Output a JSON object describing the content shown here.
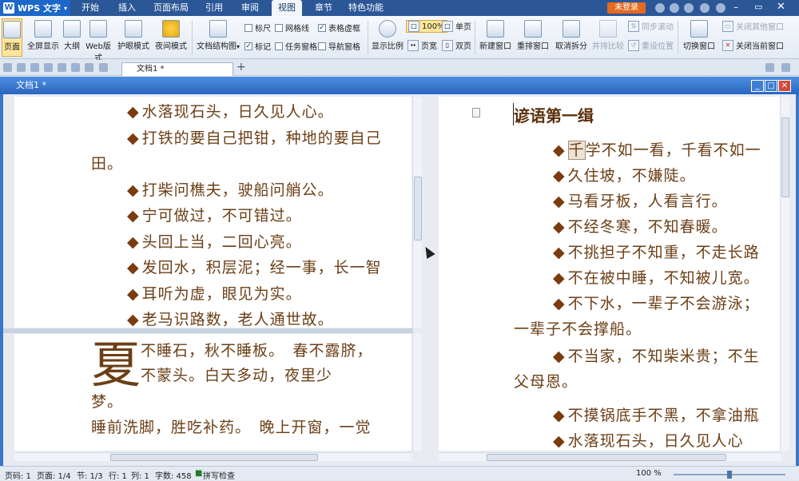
{
  "app": {
    "title": "WPS 文字",
    "login": "未登录"
  },
  "ribbon_tabs": [
    "开始",
    "插入",
    "页面布局",
    "引用",
    "审阅",
    "视图",
    "章节",
    "特色功能"
  ],
  "active_tab": "视图",
  "view_buttons": [
    "页面",
    "全屏显示",
    "大纲",
    "Web版式",
    "护眼模式",
    "夜间模式",
    "文档结构图"
  ],
  "checkboxes": [
    {
      "label": "标尺",
      "checked": false
    },
    {
      "label": "网格线",
      "checked": false
    },
    {
      "label": "表格虚框",
      "checked": true
    },
    {
      "label": "标记",
      "checked": true
    },
    {
      "label": "任务窗格",
      "checked": false
    },
    {
      "label": "导航窗格",
      "checked": false
    }
  ],
  "zoom_group": {
    "display_ratio": "显示比例",
    "zoom100": "100%",
    "page_width": "页宽",
    "single_page": "单页",
    "two_page": "双页"
  },
  "window_group": [
    "新建窗口",
    "重排窗口",
    "取消拆分",
    "并排比较"
  ],
  "sync_scroll": "同步滚动",
  "reset_pos": "重设位置",
  "switch_window": "切换窗口",
  "close_other": "关闭其他窗口",
  "close_current": "关闭当前窗口",
  "doc_tab": "文档1 *",
  "doc_window_title": "文档1 *",
  "left_top_lines": [
    {
      "bullet": true,
      "text": "水落现石头，日久见人心。"
    },
    {
      "bullet": true,
      "text": "打铁的要自己把钳，种地的要自己"
    },
    {
      "bullet": false,
      "text": "田。"
    },
    {
      "bullet": true,
      "text": "打柴问樵夫，驶船问艄公。"
    },
    {
      "bullet": true,
      "text": "宁可做过，不可错过。"
    },
    {
      "bullet": true,
      "text": "头回上当，二回心亮。"
    },
    {
      "bullet": true,
      "text": "发回水，积层泥；经一事，长一智"
    },
    {
      "bullet": true,
      "text": "耳听为虚，眼见为实。"
    },
    {
      "bullet": true,
      "text": "老马识路数，老人通世故。"
    }
  ],
  "left_bottom": {
    "big_char": "夏",
    "lines": [
      "不睡石，秋不睡板。　春不露脐，",
      "不蒙头。白天多动，夜里少",
      "梦。",
      "睡前洗脚，胜吃补药。　晚上开窗，一觉"
    ]
  },
  "right": {
    "heading": "谚语第一缉",
    "lines": [
      {
        "bullet": true,
        "text": "千学不如一看，千看不如一"
      },
      {
        "bullet": true,
        "text": "久住坡，不嫌陡。"
      },
      {
        "bullet": true,
        "text": "马看牙板，人看言行。"
      },
      {
        "bullet": true,
        "text": "不经冬寒，不知春暖。"
      },
      {
        "bullet": true,
        "text": "不挑担子不知重，不走长路"
      },
      {
        "bullet": true,
        "text": "不在被中睡，不知被儿宽。"
      },
      {
        "bullet": true,
        "text": "不下水，一辈子不会游泳；"
      },
      {
        "bullet": false,
        "text": "一辈子不会撑船。"
      },
      {
        "bullet": true,
        "text": "不当家，不知柴米贵；不生"
      },
      {
        "bullet": false,
        "text": "父母恩。"
      },
      {
        "bullet": true,
        "text": "不摸锅底手不黑，不拿油瓶"
      },
      {
        "bullet": true,
        "text": "水落现石头，日久见人心"
      }
    ]
  },
  "status": {
    "page": "页码: 1",
    "pages": "页面: 1/4",
    "section": "节: 1/3",
    "row": "行: 1",
    "col": "列: 1",
    "words": "字数: 458",
    "spell": "拼写检查",
    "zoom": "100 %"
  },
  "zoom_fraction": 0.5,
  "colors": {
    "text": "#6b3f16",
    "bullet": "#7a3b0e",
    "titlebar": "#2b5797"
  }
}
